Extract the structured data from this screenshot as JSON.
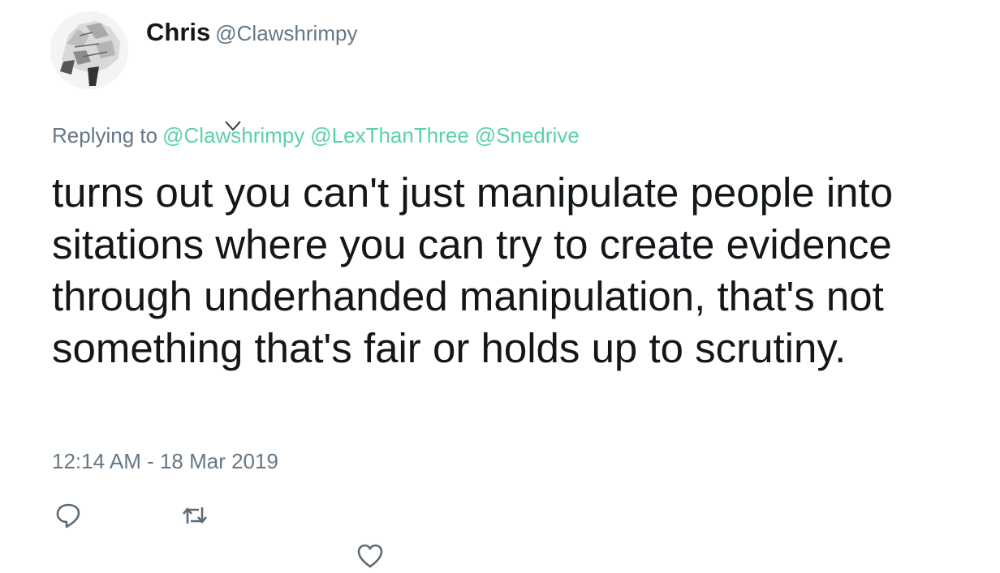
{
  "tweet": {
    "author": {
      "display_name": "Chris",
      "handle": "@Clawshrimpy"
    },
    "replying": {
      "label": "Replying to",
      "mentions": [
        "@Clawshrimpy",
        "@LexThanThree",
        "@Snedrive"
      ]
    },
    "text": "turns out you can't just manipulate people into sitations where you can try to create evidence through underhanded manipulation, that's not something that's fair or holds up to scrutiny.",
    "timestamp": "12:14 AM - 18 Mar 2019"
  },
  "actions": {
    "reply_icon": "reply-icon",
    "retweet_icon": "retweet-icon",
    "like_icon": "heart-icon"
  },
  "colors": {
    "mention": "#5bd1ab",
    "muted": "#657786",
    "text": "#14171a",
    "icon": "#5c6b77"
  }
}
